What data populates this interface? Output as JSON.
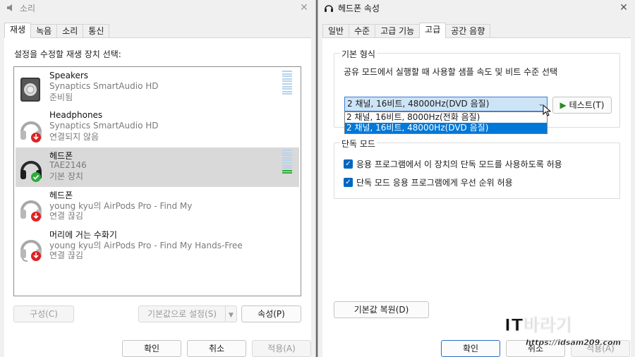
{
  "left_window": {
    "title": "소리",
    "close_glyph": "✕",
    "tabs": [
      "재생",
      "녹음",
      "소리",
      "통신"
    ],
    "instruction": "설정을 수정할 재생 장치 선택:",
    "devices": [
      {
        "name": "Speakers",
        "sub": "Synaptics SmartAudio HD",
        "status": "준비됨",
        "icon": "speaker-icon",
        "level_active": false
      },
      {
        "name": "Headphones",
        "sub": "Synaptics SmartAudio HD",
        "status": "연결되지 않음",
        "icon": "headphones-disconnected-icon",
        "level_active": false
      },
      {
        "name": "헤드폰",
        "sub": "TAE2146",
        "status": "기본 장치",
        "icon": "headphones-default-icon",
        "level_active": true
      },
      {
        "name": "헤드폰",
        "sub": "young kyu의 AirPods Pro - Find My",
        "status": "연결 끊김",
        "icon": "headphones-disconnected-icon",
        "level_active": false
      },
      {
        "name": "머리에 거는 수화기",
        "sub": "young kyu의 AirPods Pro - Find My Hands-Free",
        "status": "연결 끊김",
        "icon": "headset-disconnected-icon",
        "level_active": false
      }
    ],
    "buttons": {
      "configure": "구성(C)",
      "set_default": "기본값으로 설정(S)",
      "properties": "속성(P)",
      "ok": "확인",
      "cancel": "취소",
      "apply": "적용(A)"
    }
  },
  "right_window": {
    "title": "헤드폰 속성",
    "close_glyph": "✕",
    "tabs": [
      "일반",
      "수준",
      "고급 기능",
      "고급",
      "공간 음향"
    ],
    "active_tab": "고급",
    "default_format": {
      "group_title": "기본 형식",
      "description": "공유 모드에서 실행할 때 사용할 샘플 속도 및 비트 수준 선택",
      "selected": "2 채널, 16비트, 48000Hz(DVD 음질)",
      "options": [
        "2 채널, 16비트, 8000Hz(전화 음질)",
        "2 채널, 16비트, 48000Hz(DVD 음질)"
      ],
      "highlighted_option": 1,
      "test_button": "테스트(T)"
    },
    "exclusive_mode": {
      "group_title": "단독 모드",
      "option1": "응용 프로그램에서 이 장치의 단독 모드를 사용하도록 허용",
      "option1_checked": true,
      "option2": "단독 모드 응용 프로그램에게 우선 순위 허용",
      "option2_checked": true
    },
    "restore_defaults": "기본값 복원(D)",
    "buttons": {
      "ok": "확인",
      "cancel": "취소",
      "apply": "적용(A)"
    }
  },
  "watermark": {
    "text": "IT바라기",
    "url": "https://idsam209.com"
  },
  "colors": {
    "accent": "#0078d7",
    "level_on": "#2eac3b",
    "level_off": "#b7d3ea",
    "default_badge": "#2eac3b",
    "disconnected_badge": "#e02020"
  }
}
